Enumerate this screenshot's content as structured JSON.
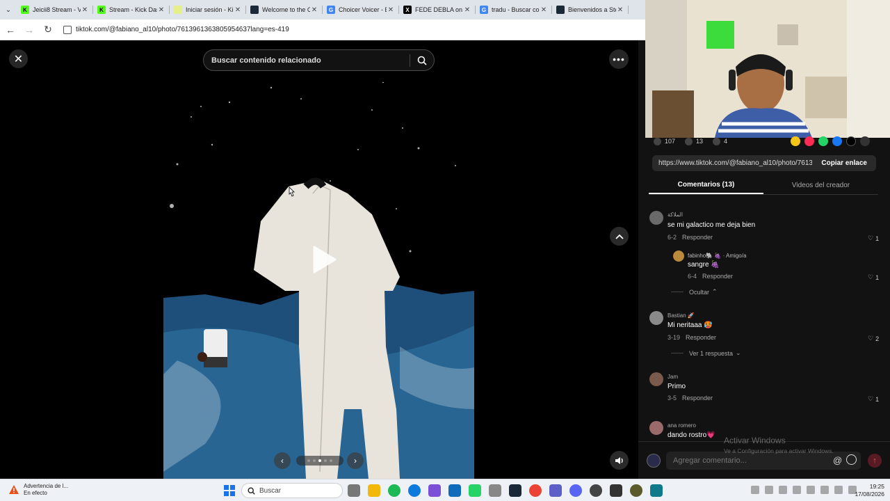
{
  "browser": {
    "tabs": [
      {
        "title": "Jeicii8 Stream - V",
        "fav_color": "#53fc18",
        "fav_glyph": "K"
      },
      {
        "title": "Stream - Kick Das",
        "fav_color": "#53fc18",
        "fav_glyph": "K"
      },
      {
        "title": "Iniciar sesión - Ki",
        "fav_color": "#e6f08a",
        "fav_glyph": ""
      },
      {
        "title": "Welcome to the C",
        "fav_color": "#1b2838",
        "fav_glyph": ""
      },
      {
        "title": "Choicer Voicer - E",
        "fav_color": "#4285f4",
        "fav_glyph": "G"
      },
      {
        "title": "FEDE DEBLA on",
        "fav_color": "#000000",
        "fav_glyph": "X"
      },
      {
        "title": "tradu - Buscar co",
        "fav_color": "#4285f4",
        "fav_glyph": "G"
      },
      {
        "title": "Bienvenidos a Ste",
        "fav_color": "#1b2838",
        "fav_glyph": ""
      }
    ],
    "url": "tiktok.com/@fabiano_al10/photo/7613961363805954637lang=es-419"
  },
  "viewer": {
    "search_placeholder": "Buscar contenido relacionado",
    "carousel_dots": 5,
    "active_dot": 2
  },
  "post": {
    "likes": "107",
    "comments": "13",
    "saves": "4",
    "link": "https://www.tiktok.com/@fabiano_al10/photo/7613...",
    "copy_label": "Copiar enlace",
    "tab_comments": "Comentarios (13)",
    "tab_videos": "Videos del creador"
  },
  "comments": [
    {
      "user": "الملاكة",
      "text": "se mi galactico me deja bien",
      "date": "6-2",
      "reply": "Responder",
      "likes": "1"
    },
    {
      "user": "fabinho🐘 🍇 · Amigo/a",
      "text": "sangre 🍇",
      "date": "6-4",
      "reply": "Responder",
      "likes": "1"
    },
    {
      "user": "Bastian 🚀",
      "text": "Mi neritaaa 🥵",
      "date": "3-19",
      "reply": "Responder",
      "likes": "2"
    },
    {
      "user": "Jam",
      "text": "Primo",
      "date": "3-5",
      "reply": "Responder",
      "likes": "1"
    },
    {
      "user": "ana romero",
      "text": "dando rostro💗",
      "date": "",
      "reply": "",
      "likes": ""
    }
  ],
  "threads": {
    "hide": "Ocultar",
    "view_reply": "Ver 1 respuesta"
  },
  "add_comment": {
    "placeholder": "Agregar comentario..."
  },
  "watermark": {
    "line1": "Activar Windows",
    "line2": "Ve a Configuración para activar Windows."
  },
  "taskbar": {
    "warning_title": "Advertencia de l...",
    "warning_sub": "En efecto",
    "search": "Buscar",
    "time": "19:25",
    "date": "17/08/2026"
  },
  "colors": {
    "accent": "#fe2c55",
    "panel_bg": "#121212"
  }
}
